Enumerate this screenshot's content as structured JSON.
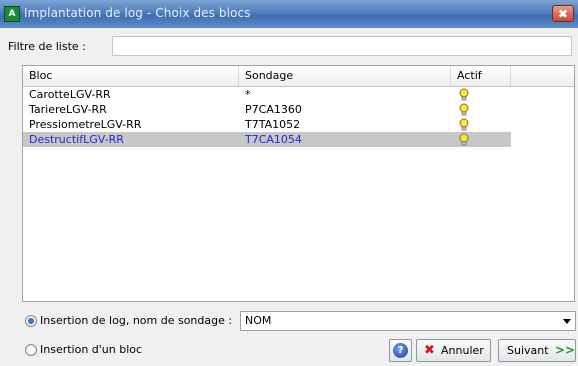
{
  "window": {
    "title": "Implantation de log - Choix des blocs",
    "close_label": "✖"
  },
  "filter": {
    "label": "Filtre de liste :",
    "value": ""
  },
  "list": {
    "columns": [
      "Bloc",
      "Sondage",
      "Actif"
    ],
    "rows": [
      {
        "bloc": "CarotteLGV-RR",
        "sondage": "*",
        "actif": true,
        "selected": false
      },
      {
        "bloc": "TariereLGV-RR",
        "sondage": "P7CA1360",
        "actif": true,
        "selected": false
      },
      {
        "bloc": "PressiometreLGV-RR",
        "sondage": "T7TA1052",
        "actif": true,
        "selected": false
      },
      {
        "bloc": "DestructifLGV-RR",
        "sondage": "T7CA1054",
        "actif": true,
        "selected": true
      }
    ]
  },
  "options": {
    "insertion_log_label": "Insertion de log, nom de sondage :",
    "insertion_bloc_label": "Insertion d'un bloc",
    "selected_option": "insertion_log",
    "sondage_name_value": "NOM"
  },
  "buttons": {
    "help_icon": "?",
    "cancel_label": "Annuler",
    "next_label": "Suivant",
    "next_arrows": ">>"
  },
  "colors": {
    "title_bar": "#4f7fbf",
    "selection_text": "#1a2fd0",
    "selection_bg": "#c7c7c7",
    "bulb": "#f5e84a",
    "cancel_icon": "#d21a1a",
    "next_icon": "#1d9a2a"
  }
}
